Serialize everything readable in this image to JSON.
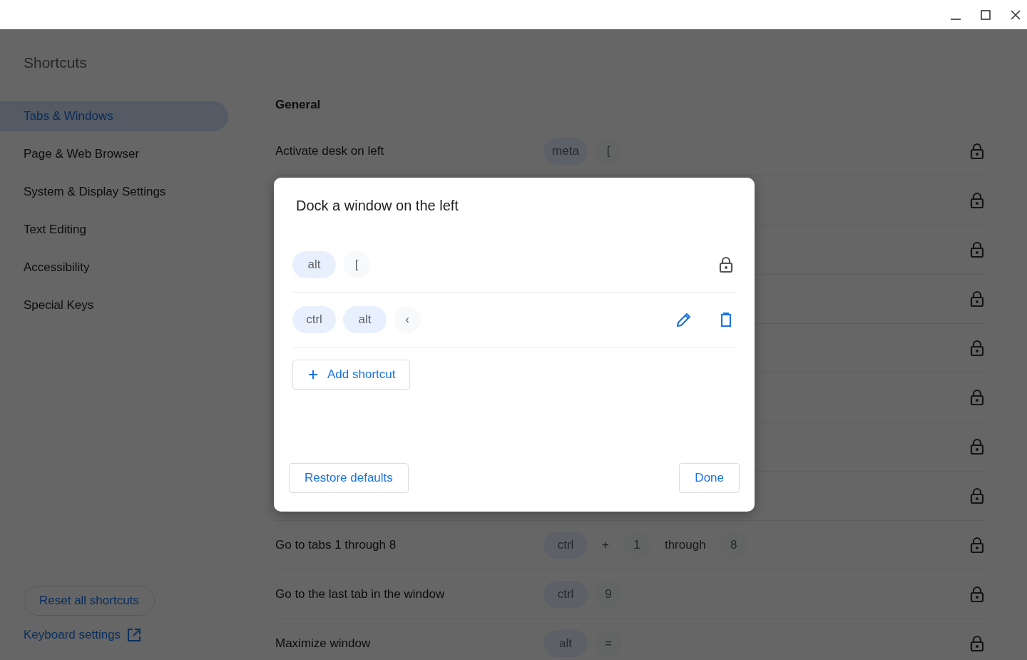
{
  "sidebar": {
    "title": "Shortcuts",
    "items": [
      {
        "label": "Tabs & Windows",
        "selected": true
      },
      {
        "label": "Page & Web Browser",
        "selected": false
      },
      {
        "label": "System & Display Settings",
        "selected": false
      },
      {
        "label": "Text Editing",
        "selected": false
      },
      {
        "label": "Accessibility",
        "selected": false
      },
      {
        "label": "Special Keys",
        "selected": false
      }
    ],
    "reset_button": "Reset all shortcuts",
    "settings_link": "Keyboard settings"
  },
  "main": {
    "section": "General",
    "rows": [
      {
        "label": "Activate desk on left",
        "keys": [
          {
            "kind": "modifier",
            "text": "meta"
          },
          {
            "kind": "key",
            "text": "["
          }
        ],
        "locked": true
      },
      {
        "locked": true
      },
      {
        "locked": true
      },
      {
        "locked": true
      },
      {
        "locked": true
      },
      {
        "locked": true
      },
      {
        "locked": true
      },
      {
        "locked": true
      },
      {
        "label": "Go to tabs 1 through 8",
        "keys": [
          {
            "kind": "modifier",
            "text": "ctrl"
          },
          {
            "kind": "separator",
            "text": "+"
          },
          {
            "kind": "key",
            "text": "1"
          },
          {
            "kind": "separator",
            "text": "through"
          },
          {
            "kind": "key",
            "text": "8"
          }
        ],
        "locked": true
      },
      {
        "label": "Go to the last tab in the window",
        "keys": [
          {
            "kind": "modifier",
            "text": "ctrl"
          },
          {
            "kind": "key",
            "text": "9"
          }
        ],
        "locked": true
      },
      {
        "label": "Maximize window",
        "keys": [
          {
            "kind": "modifier",
            "text": "alt"
          },
          {
            "kind": "key",
            "text": "="
          }
        ],
        "locked": true
      }
    ]
  },
  "dialog": {
    "title": "Dock a window on the left",
    "shortcuts": [
      {
        "keys": [
          {
            "kind": "modifier",
            "text": "alt"
          },
          {
            "kind": "key",
            "text": "["
          }
        ],
        "locked": true
      },
      {
        "keys": [
          {
            "kind": "modifier",
            "text": "ctrl"
          },
          {
            "kind": "modifier",
            "text": "alt"
          },
          {
            "kind": "key",
            "text": "‹"
          }
        ],
        "locked": false
      }
    ],
    "add_button": "Add shortcut",
    "restore_button": "Restore defaults",
    "done_button": "Done"
  }
}
